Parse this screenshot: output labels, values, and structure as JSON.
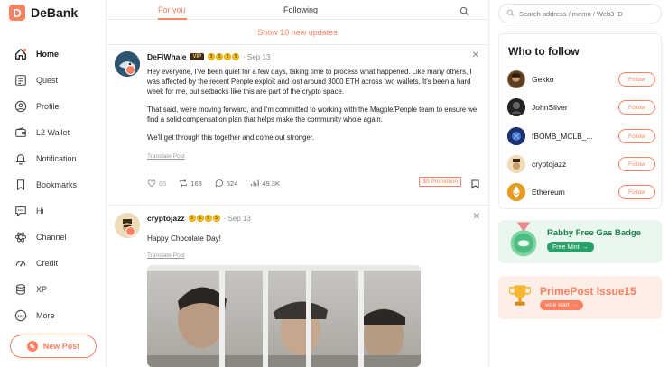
{
  "app": {
    "name": "DeBank",
    "logo_letter": "D"
  },
  "sidebar": {
    "items": [
      {
        "label": "Home",
        "icon": "home-icon",
        "active": true
      },
      {
        "label": "Quest",
        "icon": "quest-icon"
      },
      {
        "label": "Profile",
        "icon": "profile-icon"
      },
      {
        "label": "L2 Wallet",
        "icon": "wallet-icon"
      },
      {
        "label": "Notification",
        "icon": "bell-icon"
      },
      {
        "label": "Bookmarks",
        "icon": "bookmark-icon"
      },
      {
        "label": "Hi",
        "icon": "chat-icon"
      },
      {
        "label": "Channel",
        "icon": "atom-icon"
      },
      {
        "label": "Credit",
        "icon": "gauge-icon"
      },
      {
        "label": "XP",
        "icon": "stack-icon"
      },
      {
        "label": "More",
        "icon": "more-icon"
      }
    ],
    "new_post_label": "New Post"
  },
  "feed": {
    "tabs": [
      {
        "label": "For you",
        "active": true
      },
      {
        "label": "Following"
      }
    ],
    "new_updates": "Show 10 new updates",
    "posts": [
      {
        "author": "DeFiWhale",
        "vip": "VIP",
        "date": "· Sep 13",
        "paragraphs": [
          "Hey everyone, I've been quiet for a few days, taking time to process what happened. Like many others, I was affected by the recent Penple exploit and lost around 3000 ETH across two wallets. It's been a hard week for me, but setbacks like this are part of the crypto space.",
          "That said, we're moving forward, and I'm committed to working with the Magple/Penple team to ensure we find a solid compensation plan that helps make the community whole again.",
          "We'll get through this together and come out stronger."
        ],
        "translate": "Translate Post",
        "likes": "65",
        "reposts": "168",
        "comments": "524",
        "views": "49.3K",
        "promotion": "$9 Promotion"
      },
      {
        "author": "cryptojazz",
        "date": "· Sep 13",
        "text": "Happy Chocolate Day!",
        "translate": "Translate Post"
      }
    ]
  },
  "right": {
    "search_placeholder": "Search address / memo / Web3 ID",
    "who_to_follow": {
      "title": "Who to follow",
      "follow_label": "Follow",
      "users": [
        {
          "name": "Gekko",
          "color": "#6b4a2a"
        },
        {
          "name": "JohnSilver",
          "color": "#2a2a2a"
        },
        {
          "name": "fBOMB_MCLB_...",
          "color": "#1f3a8a"
        },
        {
          "name": "cryptojazz",
          "color": "#c9a46a"
        },
        {
          "name": "Ethereum",
          "color": "#e0a030"
        }
      ]
    },
    "rabby_banner": {
      "title": "Rabby Free Gas Badge",
      "button": "Free Mint"
    },
    "prime_banner": {
      "title": "PrimePost Issue15",
      "button": "vote start"
    }
  },
  "colors": {
    "accent": "#fe815f",
    "green": "#29a06a"
  }
}
